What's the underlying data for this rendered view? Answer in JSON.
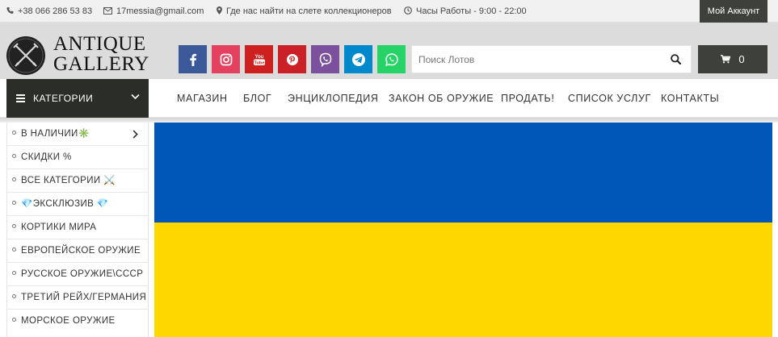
{
  "topbar": {
    "phone": "+38 066 286 53 83",
    "email": "17messia@gmail.com",
    "location": "Где нас найти на слете коллекционеров",
    "hours": "Часы Работы - 9:00 - 22:00",
    "account_label": "Мой Аккаунт",
    "phone_icon": "phone-icon",
    "email_icon": "envelope-icon",
    "location_icon": "map-pin-icon",
    "hours_icon": "clock-icon"
  },
  "logo": {
    "line1": "ANTIQUE",
    "line2": "GALLERY",
    "emblem_icon": "crossed-swords-icon"
  },
  "social": [
    {
      "name": "facebook-icon",
      "color": "#3b5998"
    },
    {
      "name": "instagram-icon",
      "color": "#e4405f"
    },
    {
      "name": "youtube-icon",
      "color": "#cd201f"
    },
    {
      "name": "pinterest-icon",
      "color": "#cb2027"
    },
    {
      "name": "viber-icon",
      "color": "#7b519d"
    },
    {
      "name": "telegram-icon",
      "color": "#0088cc"
    },
    {
      "name": "whatsapp-icon",
      "color": "#25d366"
    }
  ],
  "search": {
    "placeholder": "Поиск Лотов",
    "value": "",
    "icon": "search-icon"
  },
  "cart": {
    "count": "0",
    "icon": "shopping-cart-icon"
  },
  "nav": {
    "categories_label": "КАТЕГОРИИ",
    "menu": [
      "МАГАЗИН",
      "БЛОГ",
      "ЭНЦИКЛОПЕДИЯ",
      "ЗАКОН ОБ ОРУЖИЕ",
      "ПРОДАТЬ!",
      "СПИСОК УСЛУГ",
      "КОНТАКТЫ"
    ]
  },
  "sidebar": {
    "items": [
      {
        "label": "В НАЛИЧИИ✳️",
        "has_submenu": true
      },
      {
        "label": "СКИДКИ %"
      },
      {
        "label": "ВСЕ КАТЕГОРИИ ⚔️"
      },
      {
        "label": "💎ЭКСКЛЮЗИВ 💎"
      },
      {
        "label": "КОРТИКИ МИРА"
      },
      {
        "label": "ЕВРОПЕЙСКОЕ ОРУЖИЕ"
      },
      {
        "label": "РУССКОЕ ОРУЖИЕ\\СССР"
      },
      {
        "label": "ТРЕТИЙ РЕЙХ/ГЕРМАНИЯ"
      },
      {
        "label": "МОРСКОЕ ОРУЖИЕ"
      }
    ]
  },
  "banner": {
    "blue": "#0057b7",
    "yellow": "#ffd700"
  }
}
